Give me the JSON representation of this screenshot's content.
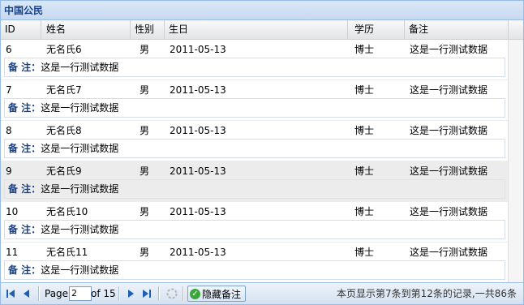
{
  "panel": {
    "title": "中国公民"
  },
  "columns": [
    "ID",
    "姓名",
    "性别",
    "生日",
    "学历",
    "备注"
  ],
  "rows": [
    {
      "id": "6",
      "name": "无名氏6",
      "gender": "男",
      "birthday": "2011-05-13",
      "education": "博士",
      "remark": "这是一行测试数据",
      "note_label": "备 注：",
      "note": "这是一行测试数据"
    },
    {
      "id": "7",
      "name": "无名氏7",
      "gender": "男",
      "birthday": "2011-05-13",
      "education": "博士",
      "remark": "这是一行测试数据",
      "note_label": "备 注：",
      "note": "这是一行测试数据"
    },
    {
      "id": "8",
      "name": "无名氏8",
      "gender": "男",
      "birthday": "2011-05-13",
      "education": "博士",
      "remark": "这是一行测试数据",
      "note_label": "备 注：",
      "note": "这是一行测试数据"
    },
    {
      "id": "9",
      "name": "无名氏9",
      "gender": "男",
      "birthday": "2011-05-13",
      "education": "博士",
      "remark": "这是一行测试数据",
      "note_label": "备 注：",
      "note": "这是一行测试数据"
    },
    {
      "id": "10",
      "name": "无名氏10",
      "gender": "男",
      "birthday": "2011-05-13",
      "education": "博士",
      "remark": "这是一行测试数据",
      "note_label": "备 注：",
      "note": "这是一行测试数据"
    },
    {
      "id": "11",
      "name": "无名氏11",
      "gender": "男",
      "birthday": "2011-05-13",
      "education": "博士",
      "remark": "这是一行测试数据",
      "note_label": "备 注：",
      "note": "这是一行测试数据"
    }
  ],
  "selected_row": 3,
  "pager": {
    "page_label": "Page",
    "current_page": "2",
    "of_label": "of 15",
    "hide_notes_button": "隐藏备注",
    "status_text": "本页显示第7条到第12条的记录,一共86条"
  },
  "colors": {
    "header_text": "#15428b",
    "border": "#99bbe8",
    "selected_row": "#ececec",
    "nav_icon": "#1d5fb5"
  },
  "icons": [
    "first-page-icon",
    "prev-page-icon",
    "next-page-icon",
    "last-page-icon",
    "refresh-icon",
    "check-icon"
  ]
}
